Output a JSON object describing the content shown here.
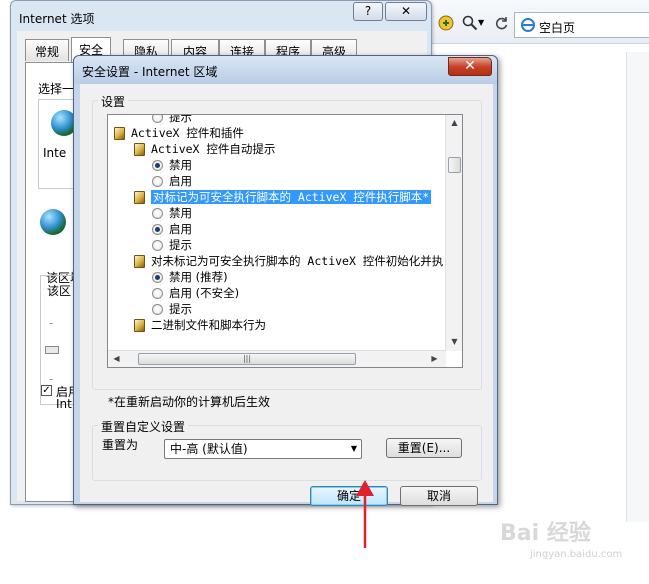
{
  "browser": {
    "home_label": "空白页"
  },
  "options_window": {
    "title": "Internet 选项",
    "help_label": "?",
    "close_label": "✕",
    "tabs": [
      "常规",
      "安全",
      "隐私",
      "内容",
      "连接",
      "程序",
      "高级"
    ],
    "partial_labels": {
      "select": "选择一",
      "zone": "Inte",
      "level1": "该区域",
      "level2": "该区",
      "protect": "启用",
      "protect2": "Int"
    }
  },
  "security_dialog": {
    "title": "安全设置 - Internet 区域",
    "close_label": "✕",
    "settings_group_label": "设置",
    "tree": [
      {
        "type": "radio",
        "label": "提示",
        "checked": false
      },
      {
        "type": "folder",
        "label": "ActiveX 控件和插件"
      },
      {
        "type": "folder",
        "label": "ActiveX 控件自动提示",
        "indent": true
      },
      {
        "type": "radio",
        "label": "禁用",
        "checked": true
      },
      {
        "type": "radio",
        "label": "启用",
        "checked": false
      },
      {
        "type": "folder",
        "label": "对标记为可安全执行脚本的 ActiveX 控件执行脚本*",
        "indent": true,
        "selected": true
      },
      {
        "type": "radio",
        "label": "禁用",
        "checked": false
      },
      {
        "type": "radio",
        "label": "启用",
        "checked": true
      },
      {
        "type": "radio",
        "label": "提示",
        "checked": false
      },
      {
        "type": "folder",
        "label": "对未标记为可安全执行脚本的 ActiveX 控件初始化并执",
        "indent": true
      },
      {
        "type": "radio",
        "label": "禁用 (推荐)",
        "checked": true
      },
      {
        "type": "radio",
        "label": "启用 (不安全)",
        "checked": false
      },
      {
        "type": "radio",
        "label": "提示",
        "checked": false
      },
      {
        "type": "folder",
        "label": "二进制文件和脚本行为",
        "indent": true
      }
    ],
    "restart_note": "*在重新启动你的计算机后生效",
    "reset_group_label": "重置自定义设置",
    "reset_to_label": "重置为",
    "reset_select_value": "中-高 (默认值)",
    "reset_button": "重置(E)...",
    "ok_button": "确定",
    "cancel_button": "取消"
  },
  "watermark": {
    "brand": "Bai 经验",
    "url": "jingyan.baidu.com"
  },
  "colors": {
    "selection": "#3399ff",
    "arrow": "#e0202a"
  }
}
